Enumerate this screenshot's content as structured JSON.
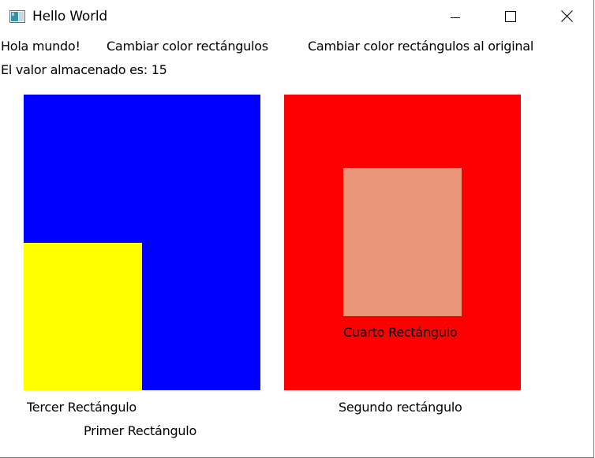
{
  "window": {
    "title": "Hello World",
    "icon": "app-window-icon",
    "controls": {
      "minimize_icon": "minimize-icon",
      "maximize_icon": "maximize-icon",
      "close_icon": "close-icon"
    }
  },
  "toolbar": {
    "greeting": "Hola mundo!",
    "change_color_button": "Cambiar color rectángulos",
    "restore_color_button": "Cambiar color rectángulos al original"
  },
  "stored_value": {
    "text": "El valor almacenado es: 15"
  },
  "rectangles": {
    "first": {
      "label": "Primer Rectángulo",
      "color": "#0000FF"
    },
    "second": {
      "label": "Segundo rectángulo",
      "color": "#FF0000"
    },
    "third": {
      "label": "Tercer Rectángulo",
      "color": "#FFFF00"
    },
    "fourth": {
      "label": "Cuarto Rectángulo",
      "color": "#E9967A"
    }
  }
}
